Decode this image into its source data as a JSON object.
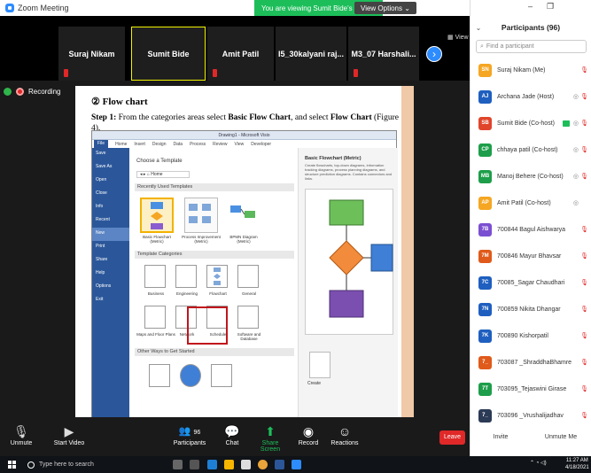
{
  "window": {
    "title": "Zoom Meeting",
    "banner": "You are viewing Sumit Bide's screen",
    "view_options": "View Options"
  },
  "strip": {
    "tiles": [
      "Suraj Nikam",
      "Sumit Bide",
      "Amit Patil",
      "I5_30kalyani raj...",
      "M3_07 Harshali..."
    ],
    "next": "›",
    "view": "View"
  },
  "recording": "Recording",
  "document": {
    "heading": "② Flow chart",
    "step_prefix": "Step 1:",
    "step_text_1": " From the categories areas select ",
    "step_bold_1": "Basic Flow Chart",
    "step_text_2": ", and select ",
    "step_bold_2": "Flow Chart",
    "step_text_3": " (Figure 4).",
    "visio": {
      "title": "Drawing1 - Microsoft Visio",
      "menu": [
        "File",
        "Home",
        "Insert",
        "Design",
        "Data",
        "Process",
        "Review",
        "View",
        "Developer"
      ],
      "left_items": [
        "Save",
        "Save As",
        "Open",
        "Close",
        "Info",
        "Recent",
        "New",
        "Print",
        "Share",
        "Help",
        "Options",
        "Exit"
      ],
      "choose_template": "Choose a Template",
      "nav_home": "Home",
      "recent_band": "Recently Used Templates",
      "recent": [
        "Basic Flowchart (Metric)",
        "Process Improvement (Metric)",
        "BPMN Diagram (Metric)"
      ],
      "categories_band": "Template Categories",
      "categories_row1": [
        "Business",
        "Engineering",
        "Flowchart",
        "General"
      ],
      "categories_row2": [
        "Maps and Floor Plans",
        "Network",
        "Schedule",
        "Software and Database"
      ],
      "other_band": "Other Ways to Get Started",
      "right_title": "Basic Flowchart (Metric)",
      "right_desc": "Create flowcharts, top-down diagrams, information tracking diagrams, process planning diagrams, and structure prediction diagrams. Contains connectors and links.",
      "create": "Create"
    }
  },
  "toolbar": {
    "unmute": "Unmute",
    "start_video": "Start Video",
    "participants": "Participants",
    "participants_count": "96",
    "chat": "Chat",
    "share_screen": "Share Screen",
    "record": "Record",
    "reactions": "Reactions",
    "leave": "Leave"
  },
  "panel": {
    "title": "Participants (96)",
    "search_placeholder": "Find a participant",
    "participants": [
      {
        "initials": "SN",
        "name": "Suraj Nikam (Me)",
        "color": "#f5a623"
      },
      {
        "initials": "AJ",
        "name": "Archana Jade (Host)",
        "color": "#1f5fbf"
      },
      {
        "initials": "SB",
        "name": "Sumit Bide (Co-host)",
        "color": "#e0452b"
      },
      {
        "initials": "CP",
        "name": "chhaya patil (Co-host)",
        "color": "#1e9e4a"
      },
      {
        "initials": "MB",
        "name": "Manoj Behere (Co-host)",
        "color": "#1e9e4a"
      },
      {
        "initials": "AP",
        "name": "Amit Patil (Co-host)",
        "color": "#f5a623"
      },
      {
        "initials": "7B",
        "name": "700844 Bagul Aishwarya",
        "color": "#7b4fd1"
      },
      {
        "initials": "7M",
        "name": "700846 Mayur Bhavsar",
        "color": "#e05a1b"
      },
      {
        "initials": "7C",
        "name": "70085_Sagar Chaudhari",
        "color": "#1f5fbf"
      },
      {
        "initials": "7N",
        "name": "700859 Nikita Dhangar",
        "color": "#1f5fbf"
      },
      {
        "initials": "7K",
        "name": "700890 Kishorpatil",
        "color": "#1f5fbf"
      },
      {
        "initials": "7_",
        "name": "703087 _ShraddhaBhamre",
        "color": "#e05a1b"
      },
      {
        "initials": "7T",
        "name": "703095_Tejaswini Girase",
        "color": "#1e9e4a"
      },
      {
        "initials": "7_",
        "name": "703096 _Vrushalijadhav",
        "color": "#2b3a55"
      }
    ],
    "invite": "Invite",
    "unmute_me": "Unmute Me"
  },
  "taskbar": {
    "search": "Type here to search",
    "time": "11:27 AM",
    "date": "4/18/2021"
  },
  "colors": {
    "zoom_blue": "#2d8cff",
    "green": "#1dbe5a",
    "red": "#e02828"
  }
}
